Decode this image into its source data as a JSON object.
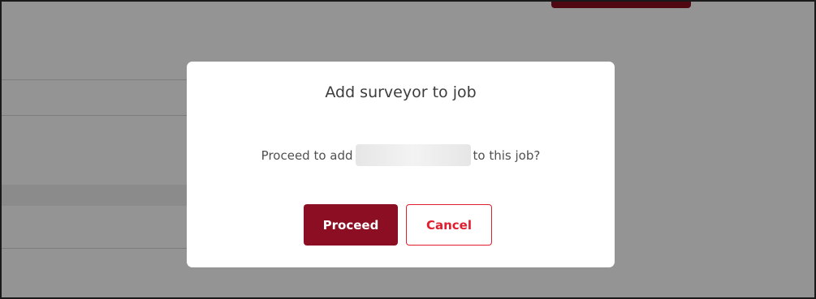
{
  "dialog": {
    "title": "Add surveyor to job",
    "message_prefix": "Proceed to add",
    "message_suffix": "to this job?",
    "proceed_label": "Proceed",
    "cancel_label": "Cancel"
  },
  "colors": {
    "primary": "#8b0e22",
    "cancel_accent": "#e01e2e",
    "overlay": "rgba(0,0,0,0.42)"
  }
}
